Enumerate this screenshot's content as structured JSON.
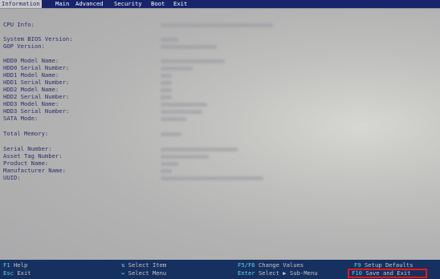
{
  "tabs": [
    {
      "label": "Information",
      "active": true
    },
    {
      "label": "Main",
      "active": false
    },
    {
      "label": "Advanced",
      "active": false
    },
    {
      "label": "Security",
      "active": false
    },
    {
      "label": "Boot",
      "active": false
    },
    {
      "label": "Exit",
      "active": false
    }
  ],
  "info_labels": {
    "cpu_info": "CPU Info:",
    "system_bios_version": "System BIOS Version:",
    "gop_version": "GOP Version:",
    "hdd0_model": "HDD0 Model Name:",
    "hdd0_serial": "HDD0 Serial Number:",
    "hdd1_model": "HDD1 Model Name:",
    "hdd1_serial": "HDD1 Serial Number:",
    "hdd2_model": "HDD2 Model Name:",
    "hdd2_serial": "HDD2 Serial Number:",
    "hdd3_model": "HDD3 Model Name:",
    "hdd3_serial": "HDD3 Serial Number:",
    "sata_mode": "SATA Mode:",
    "total_memory": "Total Memory:",
    "serial_number": "Serial Number:",
    "asset_tag": "Asset Tag Number:",
    "product_name": "Product Name:",
    "manufacturer": "Manufacturer Name:",
    "uuid": "UUID:"
  },
  "footer": {
    "f1_key": "F1",
    "f1_desc": "Help",
    "esc_key": "Esc",
    "esc_desc": "Exit",
    "updown_key": "⇅",
    "updown_desc": "Select Item",
    "leftright_key": "↔",
    "leftright_desc": "Select Menu",
    "f5f6_key": "F5/F6",
    "f5f6_desc": "Change Values",
    "enter_key": "Enter",
    "enter_desc": "Select ▶ Sub-Menu",
    "f9_key": "F9",
    "f9_desc": "Setup Defaults",
    "f10_key": "F10",
    "f10_desc": "Save and Exit"
  },
  "colors": {
    "tabbar": "#17236a",
    "content_bg": "#b8b8b8",
    "label_text": "#2a2f6a",
    "footer_bg": "#163060",
    "key_text": "#58d6e8",
    "highlight_box": "#e21818"
  }
}
